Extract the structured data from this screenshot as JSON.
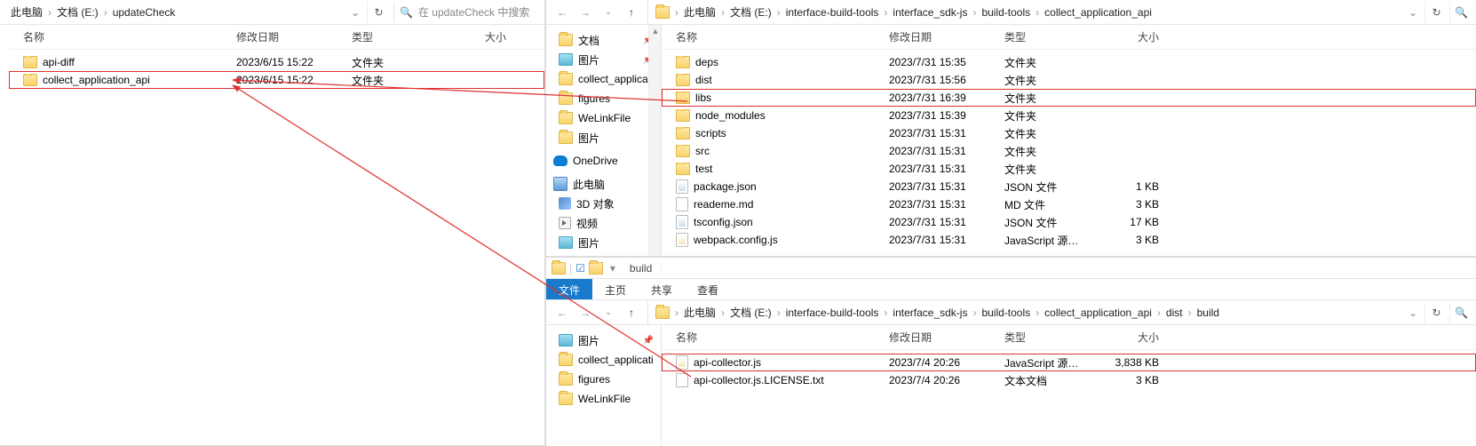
{
  "left_pane": {
    "breadcrumbs": [
      "此电脑",
      "文档 (E:)",
      "updateCheck"
    ],
    "search_placeholder": "在 updateCheck 中搜索",
    "columns": {
      "name": "名称",
      "date": "修改日期",
      "type": "类型",
      "size": "大小"
    },
    "rows": [
      {
        "name": "api-diff",
        "date": "2023/6/15 15:22",
        "type": "文件夹",
        "size": "",
        "icon": "folder"
      },
      {
        "name": "collect_application_api",
        "date": "2023/6/15 15:22",
        "type": "文件夹",
        "size": "",
        "icon": "folder",
        "highlight": true
      }
    ]
  },
  "right_top": {
    "breadcrumbs": [
      "此电脑",
      "文档 (E:)",
      "interface-build-tools",
      "interface_sdk-js",
      "build-tools",
      "collect_application_api"
    ],
    "sidebar": [
      {
        "label": "文档",
        "icon": "folder",
        "pin": true
      },
      {
        "label": "图片",
        "icon": "pic",
        "pin": true
      },
      {
        "label": "collect_applicati",
        "icon": "folder"
      },
      {
        "label": "figures",
        "icon": "folder"
      },
      {
        "label": "WeLinkFile",
        "icon": "folder"
      },
      {
        "label": "图片",
        "icon": "folder"
      },
      {
        "label": "OneDrive",
        "icon": "onedrive",
        "group": true
      },
      {
        "label": "此电脑",
        "icon": "pc",
        "group": true
      },
      {
        "label": "3D 对象",
        "icon": "obj3d"
      },
      {
        "label": "视频",
        "icon": "vid"
      },
      {
        "label": "图片",
        "icon": "pic"
      }
    ],
    "columns": {
      "name": "名称",
      "date": "修改日期",
      "type": "类型",
      "size": "大小"
    },
    "rows": [
      {
        "name": "deps",
        "date": "2023/7/31 15:35",
        "type": "文件夹",
        "size": "",
        "icon": "folder"
      },
      {
        "name": "dist",
        "date": "2023/7/31 15:56",
        "type": "文件夹",
        "size": "",
        "icon": "folder"
      },
      {
        "name": "libs",
        "date": "2023/7/31 16:39",
        "type": "文件夹",
        "size": "",
        "icon": "folder",
        "highlight": true
      },
      {
        "name": "node_modules",
        "date": "2023/7/31 15:39",
        "type": "文件夹",
        "size": "",
        "icon": "folder"
      },
      {
        "name": "scripts",
        "date": "2023/7/31 15:31",
        "type": "文件夹",
        "size": "",
        "icon": "folder"
      },
      {
        "name": "src",
        "date": "2023/7/31 15:31",
        "type": "文件夹",
        "size": "",
        "icon": "folder"
      },
      {
        "name": "test",
        "date": "2023/7/31 15:31",
        "type": "文件夹",
        "size": "",
        "icon": "folder"
      },
      {
        "name": "package.json",
        "date": "2023/7/31 15:31",
        "type": "JSON 文件",
        "size": "1 KB",
        "icon": "json"
      },
      {
        "name": "reademe.md",
        "date": "2023/7/31 15:31",
        "type": "MD 文件",
        "size": "3 KB",
        "icon": "file"
      },
      {
        "name": "tsconfig.json",
        "date": "2023/7/31 15:31",
        "type": "JSON 文件",
        "size": "17 KB",
        "icon": "json"
      },
      {
        "name": "webpack.config.js",
        "date": "2023/7/31 15:31",
        "type": "JavaScript 源文件",
        "size": "3 KB",
        "icon": "js"
      }
    ]
  },
  "right_bot": {
    "window_title": "build",
    "tabs": {
      "file": "文件",
      "home": "主页",
      "share": "共享",
      "view": "查看"
    },
    "breadcrumbs": [
      "此电脑",
      "文档 (E:)",
      "interface-build-tools",
      "interface_sdk-js",
      "build-tools",
      "collect_application_api",
      "dist",
      "build"
    ],
    "sidebar": [
      {
        "label": "图片",
        "icon": "pic",
        "pin": true
      },
      {
        "label": "collect_applicati",
        "icon": "folder"
      },
      {
        "label": "figures",
        "icon": "folder"
      },
      {
        "label": "WeLinkFile",
        "icon": "folder"
      }
    ],
    "columns": {
      "name": "名称",
      "date": "修改日期",
      "type": "类型",
      "size": "大小"
    },
    "rows": [
      {
        "name": "api-collector.js",
        "date": "2023/7/4 20:26",
        "type": "JavaScript 源文件",
        "size": "3,838 KB",
        "icon": "js",
        "highlight": true
      },
      {
        "name": "api-collector.js.LICENSE.txt",
        "date": "2023/7/4 20:26",
        "type": "文本文档",
        "size": "3 KB",
        "icon": "file"
      }
    ]
  }
}
